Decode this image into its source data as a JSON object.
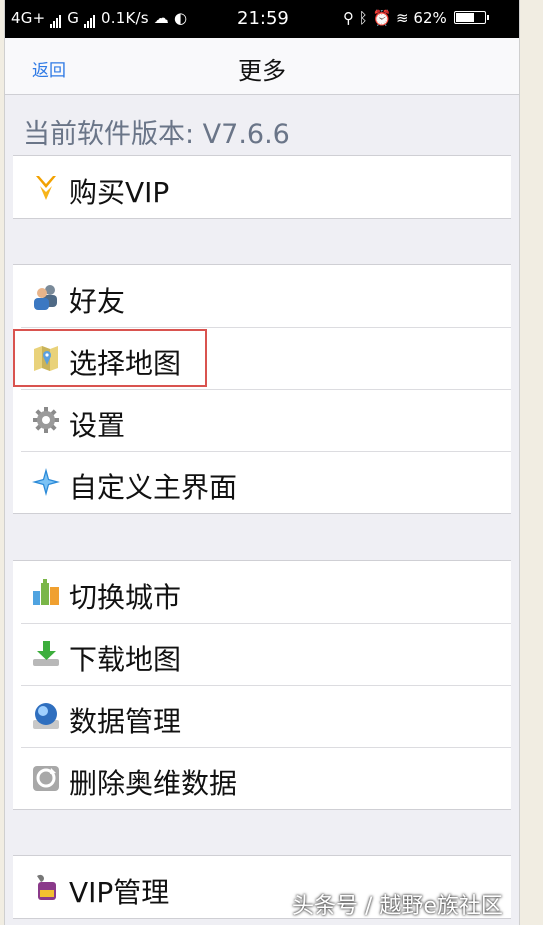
{
  "status": {
    "left_text": "4G+",
    "g_text": "G",
    "speed": "0.1K/s",
    "time": "21:59",
    "battery": "62%"
  },
  "nav": {
    "back": "返回",
    "title": "更多"
  },
  "version_text": "当前软件版本: V7.6.6",
  "groups": [
    {
      "items": [
        {
          "label": "购买VIP",
          "icon": "vip-diamond-icon"
        }
      ]
    },
    {
      "items": [
        {
          "label": "好友",
          "icon": "friends-icon"
        },
        {
          "label": "选择地图",
          "icon": "map-select-icon"
        },
        {
          "label": "设置",
          "icon": "gear-icon"
        },
        {
          "label": "自定义主界面",
          "icon": "compass-star-icon"
        }
      ]
    },
    {
      "items": [
        {
          "label": "切换城市",
          "icon": "city-buildings-icon"
        },
        {
          "label": "下载地图",
          "icon": "download-icon"
        },
        {
          "label": "数据管理",
          "icon": "database-icon"
        },
        {
          "label": "删除奥维数据",
          "icon": "delete-data-icon"
        }
      ]
    },
    {
      "items": [
        {
          "label": "VIP管理",
          "icon": "vip-manage-icon"
        }
      ]
    }
  ],
  "colors": {
    "link": "#2f7ae5",
    "highlight_border": "#d9534f",
    "background": "#efeff4"
  },
  "watermark": "头条号 / 越野e族社区"
}
